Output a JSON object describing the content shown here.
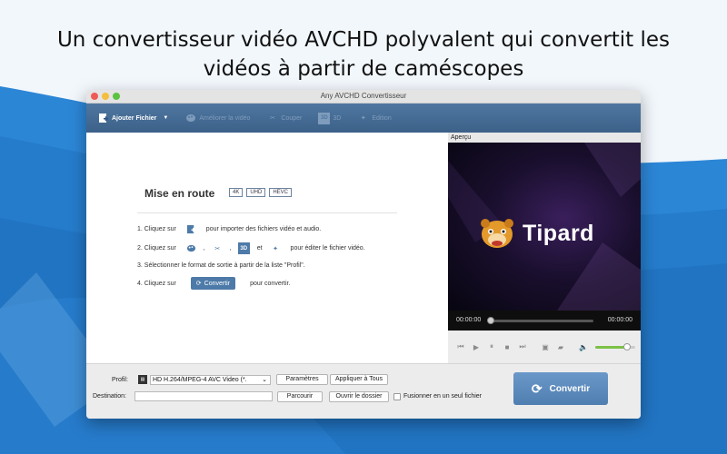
{
  "headline": {
    "line1": "Un convertisseur vidéo AVCHD polyvalent qui convertit les",
    "line2": "vidéos à partir de caméscopes"
  },
  "window": {
    "title": "Any AVCHD Convertisseur"
  },
  "toolbar": {
    "items": [
      {
        "label": "Ajouter Fichier",
        "icon": "add-file-icon",
        "enabled": true
      },
      {
        "label": "Améliorer la vidéo",
        "icon": "enhance-video-icon",
        "enabled": false
      },
      {
        "label": "Couper",
        "icon": "scissors-icon",
        "enabled": false
      },
      {
        "label": "3D",
        "icon": "3d-icon",
        "enabled": false
      },
      {
        "label": "Edition",
        "icon": "edit-effects-icon",
        "enabled": false
      }
    ]
  },
  "getting_started": {
    "title": "Mise en route",
    "badges": [
      "4K",
      "UHD",
      "HEVC"
    ],
    "step1_pre": "1. Cliquez sur",
    "step1_post": "pour importer des fichiers vidéo et audio.",
    "step2_pre": "2. Cliquez sur",
    "step2_sep1": ",",
    "step2_sep2": ",",
    "step2_and": "et",
    "step2_post": "pour éditer le fichier vidéo.",
    "step3": "3. Sélectionner le format de sortie à partir de la liste \"Profil\".",
    "step4_pre": "4. Cliquez sur",
    "step4_button": "Convertir",
    "step4_post": "pour convertir."
  },
  "preview": {
    "header": "Aperçu",
    "brand": "Tipard",
    "time_current": "00:00:00",
    "time_total": "00:00:00",
    "progress": 0,
    "volume": 0.8
  },
  "bottom": {
    "profile_label": "Profil:",
    "profile_value": "HD H.264/MPEG-4 AVC Video (*.",
    "settings_button": "Paramètres",
    "apply_all_button": "Appliquer à Tous",
    "destination_label": "Destination:",
    "destination_value": "",
    "browse_button": "Parcourir",
    "open_folder_button": "Ouvrir le dossier",
    "merge_label": "Fusionner en un seul fichier",
    "merge_checked": false,
    "convert_button": "Convertir"
  },
  "colors": {
    "toolbar": "#4f77a0",
    "accent_green": "#7bc146",
    "convert_button": "#5b8bbd",
    "background_blue": "#2e86d8"
  }
}
